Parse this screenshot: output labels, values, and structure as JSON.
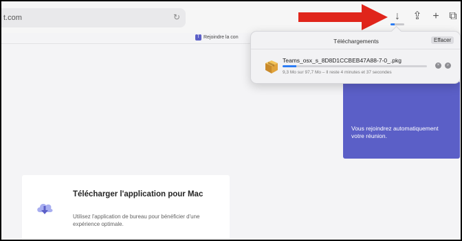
{
  "browser": {
    "address_text": "t.com",
    "reload_glyph": "↻",
    "downloads_glyph": "↓",
    "share_glyph": "⇪",
    "new_tab_glyph": "+",
    "tabs_glyph": "⧉",
    "toolbar_progress_fraction": 0.3
  },
  "bookmark": {
    "label": "Rejoindre la con",
    "icon": "teams-icon"
  },
  "tooltip": {
    "text": "Vous rejoindrez automatiquement votre réunion."
  },
  "download_card": {
    "title": "Télécharger l'application pour Mac",
    "description": "Utilisez l'application de bureau pour bénéficier d'une expérience optimale.",
    "icon": "cloud-download-icon"
  },
  "downloads_popover": {
    "title": "Téléchargements",
    "clear_label": "Effacer",
    "item": {
      "file_name": "Teams_osx_s_8D8D1CCBEB47A88-7-0_.pkg",
      "status": "9,3 Mo sur 97,7 Mo – Il reste 4 minutes et 37 secondes",
      "progress_fraction": 0.095,
      "icon": "package-icon",
      "stop_glyph": "×",
      "reveal_glyph": "⌕"
    }
  },
  "colors": {
    "teams_purple": "#5b5fc7",
    "progress_blue": "#2c7cf5",
    "annotation_red": "#e0251b"
  }
}
